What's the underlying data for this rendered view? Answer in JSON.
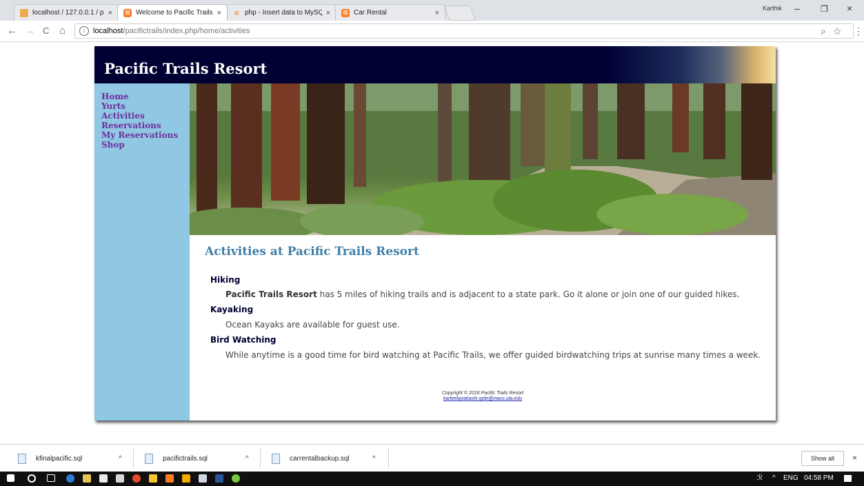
{
  "browser": {
    "tabs": [
      {
        "title": "localhost / 127.0.0.1 / pa",
        "favicon": "phpmyadmin-icon",
        "close": "×"
      },
      {
        "title": "Welcome to Pacific Trails",
        "favicon": "xampp-icon",
        "close": "×",
        "active": true
      },
      {
        "title": "php - Insert data to MySQ",
        "favicon": "stackoverflow-icon",
        "close": "×"
      },
      {
        "title": "Car Rental",
        "favicon": "xampp-icon",
        "close": "×"
      }
    ],
    "profile": "Karthik",
    "window_controls": {
      "minimize": "–",
      "restore": "❐",
      "close": "×"
    },
    "nav": {
      "back": "←",
      "forward": "→",
      "reload": "C",
      "home": "⌂"
    },
    "url": {
      "info": "i",
      "host": "localhost",
      "path": "/pacifictrails/index.php/home/activities"
    },
    "omni_icons": {
      "zoom": "⌕",
      "star": "☆",
      "menu": "⋮"
    }
  },
  "site": {
    "title": "Pacific Trails Resort",
    "nav": [
      "Home",
      "Yurts",
      "Activities",
      "Reservations",
      "My Reservations",
      "Shop"
    ],
    "heading": "Activities at Pacific Trails Resort",
    "activities": [
      {
        "title": "Hiking",
        "bold_lead": "Pacific Trails Resort",
        "desc": " has 5 miles of hiking trails and is adjacent to a state park. Go it alone or join one of our guided hikes."
      },
      {
        "title": "Kayaking",
        "desc": "Ocean Kayaks are available for guest use."
      },
      {
        "title": "Bird Watching",
        "desc": "While anytime is a good time for bird watching at Pacific Trails, we offer guided birdwatching trips at sunrise many times a week."
      }
    ],
    "footer": {
      "copyright": "Copyright © 2018 Pacific Trails Resort",
      "email": "karteekprakashr.gole@mavs.uta.edu"
    }
  },
  "downloads": {
    "items": [
      "kfinalpacific.sql",
      "pacifictrails.sql",
      "carrentalbackup.sql"
    ],
    "caret": "^",
    "show_all": "Show all",
    "close": "×"
  },
  "taskbar": {
    "tray_text": "ENG",
    "time": "04:58 PM",
    "tray_chevron": "^"
  },
  "colors": {
    "header_bg": "#000033",
    "sidebar_bg": "#90c7e3",
    "nav_link": "#6d2f9e",
    "heading": "#3f7ea6",
    "activity_title": "#000033"
  }
}
